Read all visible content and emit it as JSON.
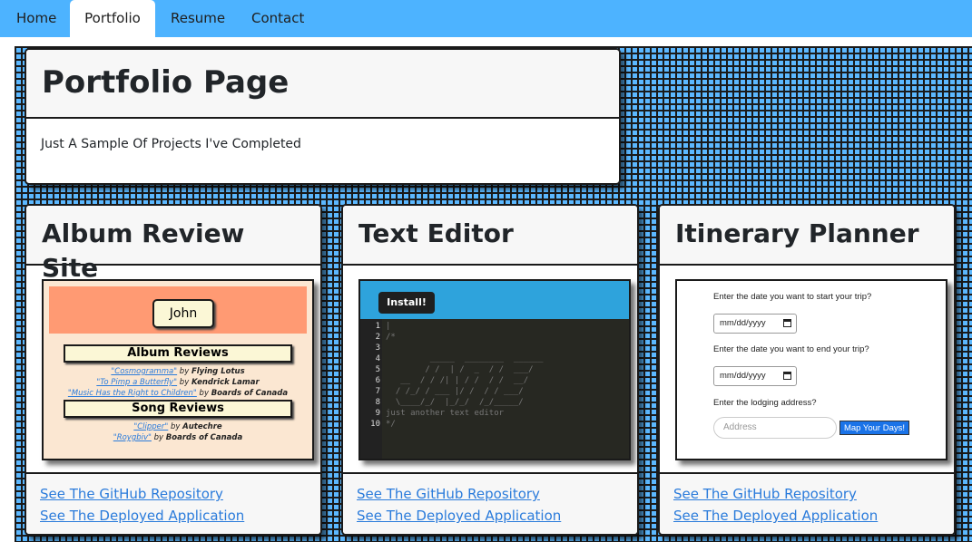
{
  "nav": {
    "tabs": [
      "Home",
      "Portfolio",
      "Resume",
      "Contact"
    ],
    "active": "Portfolio"
  },
  "hero": {
    "title": "Portfolio Page",
    "subtitle": "Just A Sample Of Projects I've Completed"
  },
  "projects": [
    {
      "title": "Album Review Site",
      "repo_link": "See The GitHub Repository",
      "app_link": "See The Deployed Application",
      "preview": {
        "name": "John",
        "album_heading": "Album Reviews",
        "albums": [
          {
            "title": "\"Cosmogramma\"",
            "by": " by ",
            "artist": "Flying Lotus"
          },
          {
            "title": "\"To Pimp a Butterfly\"",
            "by": " by ",
            "artist": "Kendrick Lamar"
          },
          {
            "title": "\"Music Has the Right to Children\"",
            "by": " by ",
            "artist": "Boards of Canada"
          }
        ],
        "song_heading": "Song Reviews",
        "songs": [
          {
            "title": "\"Clipper\"",
            "by": " by ",
            "artist": "Autechre"
          },
          {
            "title": "\"Roygbiv\"",
            "by": " by ",
            "artist": "Boards of Canada"
          }
        ]
      }
    },
    {
      "title": "Text Editor",
      "repo_link": "See The GitHub Repository",
      "app_link": "See The Deployed Application",
      "preview": {
        "install_label": "Install!",
        "line_numbers": [
          "1",
          "2",
          "3",
          "4",
          "5",
          "6",
          "7",
          "8",
          "9",
          "10"
        ],
        "code_lines": [
          "|",
          "/*",
          "",
          "         _____  ________  ______",
          "        / /  | /  _  / /  ___/",
          "   __  / / /| | / /  / /  __/",
          "  / /_/ / ___ |/ /  / / ___/",
          "  \\____/_/  |_/_/  /_/_____/",
          "just another text editor",
          "*/"
        ]
      }
    },
    {
      "title": "Itinerary Planner",
      "repo_link": "See The GitHub Repository",
      "app_link": "See The Deployed Application",
      "preview": {
        "start_label": "Enter the date you want to start your trip?",
        "start_value": "mm/dd/yyyy",
        "end_label": "Enter the date you want to end your trip?",
        "end_value": "mm/dd/yyyy",
        "lodging_label": "Enter the lodging address?",
        "address_placeholder": "Address",
        "button_label": "Map Your Days!"
      }
    }
  ],
  "colors": {
    "navbar": "#4db3ff",
    "grid_bg": "#5cb8ff",
    "link": "#2a7bdb",
    "album_header": "#ff9a73",
    "album_bg": "#fbe7d2",
    "editor_header": "#2ea3dc",
    "editor_bg": "#272822",
    "map_button": "#1a73e8"
  }
}
